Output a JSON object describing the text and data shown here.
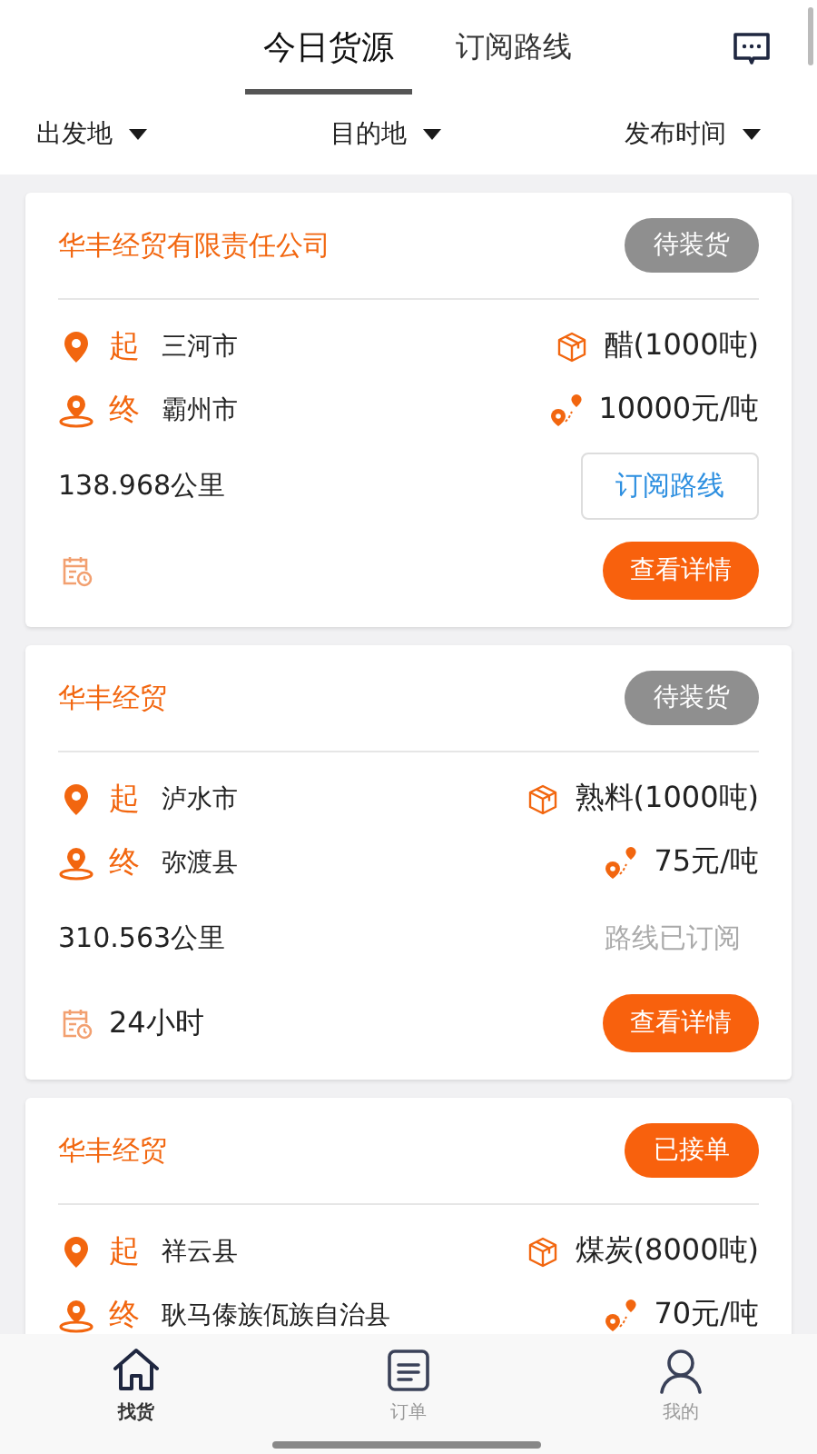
{
  "tabs": [
    {
      "label": "今日货源",
      "selected": true
    },
    {
      "label": "订阅路线",
      "selected": false
    }
  ],
  "filters": [
    {
      "label": "出发地"
    },
    {
      "label": "目的地"
    },
    {
      "label": "发布时间"
    }
  ],
  "cards": [
    {
      "company": "华丰经贸有限责任公司",
      "status": {
        "kind": "pending",
        "label": "待装货"
      },
      "start_label": "起",
      "start": "三河市",
      "end_label": "终",
      "end": "霸州市",
      "goods": "醋(1000吨)",
      "price": "10000元/吨",
      "distance": "138.968公里",
      "subscribed": false,
      "subscribe_label": "订阅路线",
      "detail_button": "查看详情"
    },
    {
      "company": "华丰经贸",
      "status": {
        "kind": "pending",
        "label": "待装货"
      },
      "start_label": "起",
      "start": "泸水市",
      "end_label": "终",
      "end": "弥渡县",
      "goods": "熟料(1000吨)",
      "price": "75元/吨",
      "distance": "310.563公里",
      "subscribed": true,
      "subscribe_label": "路线已订阅",
      "time": "24小时",
      "detail_button": "查看详情"
    },
    {
      "company": "华丰经贸",
      "status": {
        "kind": "accepted",
        "label": "已接单"
      },
      "start_label": "起",
      "start": "祥云县",
      "end_label": "终",
      "end": "耿马傣族佤族自治县",
      "goods": "煤炭(8000吨)",
      "price": "70元/吨"
    }
  ],
  "bottom_nav": [
    {
      "label": "找货",
      "kind": "home",
      "selected": true
    },
    {
      "label": "订单",
      "kind": "note",
      "selected": false
    },
    {
      "label": "我的",
      "kind": "person",
      "selected": false
    }
  ]
}
